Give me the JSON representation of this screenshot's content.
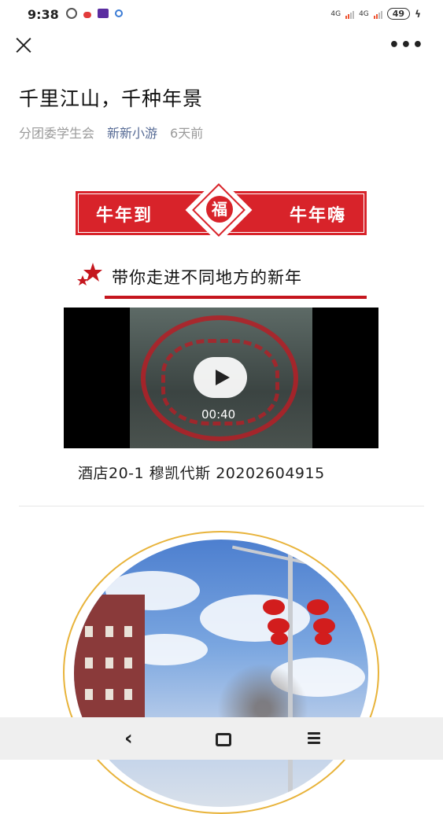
{
  "status_bar": {
    "time": "9:38",
    "battery": "49",
    "net1": "4G",
    "net2": "4G"
  },
  "article": {
    "title": "千里江山，千种年景",
    "org": "分团委学生会",
    "account": "新新小游",
    "time": "6天前"
  },
  "banner": {
    "left_text": "牛年到",
    "center_text": "福",
    "right_text": "牛年嗨"
  },
  "section_title": "带你走进不同地方的新年",
  "video": {
    "duration": "00:40",
    "caption": "酒店20-1 穆凯代斯 20202604915"
  },
  "colors": {
    "accent_red": "#d8232a",
    "link_blue": "#576b95",
    "ring_gold": "#e8b33a"
  },
  "icons": [
    "close-icon",
    "more-icon",
    "play-icon",
    "back-icon",
    "home-icon",
    "menu-icon"
  ]
}
